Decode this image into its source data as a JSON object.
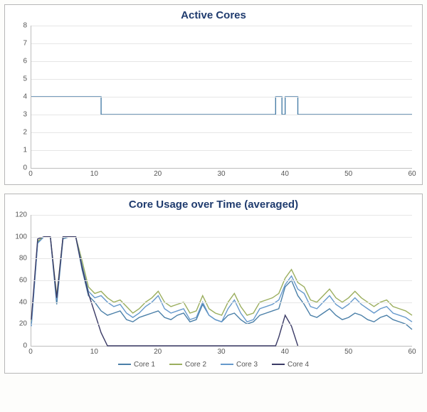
{
  "chart_data": [
    {
      "type": "line",
      "title": "Active Cores",
      "xlabel": "",
      "ylabel": "",
      "xlim": [
        0,
        60
      ],
      "ylim": [
        0,
        8
      ],
      "xticks": [
        0,
        10,
        20,
        30,
        40,
        50,
        60
      ],
      "yticks": [
        0,
        1,
        2,
        3,
        4,
        5,
        6,
        7,
        8
      ],
      "series": [
        {
          "name": "Active Cores",
          "color": "#4a7fa8",
          "x": [
            0,
            11,
            11,
            38.5,
            38.5,
            39.5,
            39.5,
            40,
            40,
            42,
            42,
            60
          ],
          "values": [
            4,
            4,
            3,
            3,
            4,
            4,
            3,
            3,
            4,
            4,
            3,
            3
          ]
        }
      ]
    },
    {
      "type": "line",
      "title": "Core Usage over Time (averaged)",
      "xlabel": "",
      "ylabel": "",
      "xlim": [
        0,
        60
      ],
      "ylim": [
        0,
        120
      ],
      "xticks": [
        0,
        10,
        20,
        30,
        40,
        50,
        60
      ],
      "yticks": [
        0,
        20,
        40,
        60,
        80,
        100,
        120
      ],
      "series": [
        {
          "name": "Core 1",
          "color": "#4a7fa8",
          "x": [
            0,
            1,
            2,
            3,
            4,
            5,
            6,
            7,
            8,
            9,
            10,
            11,
            12,
            13,
            14,
            15,
            16,
            17,
            18,
            19,
            20,
            21,
            22,
            23,
            24,
            25,
            26,
            27,
            28,
            29,
            30,
            31,
            32,
            33,
            34,
            35,
            36,
            37,
            38,
            39,
            40,
            41,
            42,
            43,
            44,
            45,
            46,
            47,
            48,
            49,
            50,
            51,
            52,
            53,
            54,
            55,
            56,
            57,
            58,
            59,
            60
          ],
          "values": [
            20,
            95,
            100,
            100,
            38,
            98,
            100,
            100,
            70,
            46,
            40,
            32,
            28,
            30,
            32,
            24,
            22,
            26,
            28,
            30,
            32,
            26,
            24,
            28,
            30,
            22,
            24,
            38,
            28,
            24,
            22,
            28,
            30,
            24,
            20,
            22,
            28,
            30,
            32,
            34,
            54,
            60,
            46,
            38,
            28,
            26,
            30,
            34,
            28,
            24,
            26,
            30,
            28,
            24,
            22,
            26,
            28,
            24,
            22,
            20,
            15
          ]
        },
        {
          "name": "Core 2",
          "color": "#9BAE5E",
          "x": [
            0,
            1,
            2,
            3,
            4,
            5,
            6,
            7,
            8,
            9,
            10,
            11,
            12,
            13,
            14,
            15,
            16,
            17,
            18,
            19,
            20,
            21,
            22,
            23,
            24,
            25,
            26,
            27,
            28,
            29,
            30,
            31,
            32,
            33,
            34,
            35,
            36,
            37,
            38,
            39,
            40,
            41,
            42,
            43,
            44,
            45,
            46,
            47,
            48,
            49,
            50,
            51,
            52,
            53,
            54,
            55,
            56,
            57,
            58,
            59,
            60
          ],
          "values": [
            22,
            96,
            100,
            100,
            46,
            100,
            100,
            100,
            78,
            54,
            48,
            50,
            44,
            40,
            42,
            36,
            30,
            34,
            40,
            44,
            50,
            40,
            36,
            38,
            40,
            30,
            32,
            46,
            34,
            30,
            28,
            40,
            48,
            36,
            28,
            30,
            40,
            42,
            44,
            48,
            62,
            70,
            58,
            54,
            42,
            40,
            46,
            52,
            44,
            40,
            44,
            50,
            44,
            40,
            36,
            40,
            42,
            36,
            34,
            32,
            28
          ]
        },
        {
          "name": "Core 3",
          "color": "#6699cc",
          "x": [
            0,
            1,
            2,
            3,
            4,
            5,
            6,
            7,
            8,
            9,
            10,
            11,
            12,
            13,
            14,
            15,
            16,
            17,
            18,
            19,
            20,
            21,
            22,
            23,
            24,
            25,
            26,
            27,
            28,
            29,
            30,
            31,
            32,
            33,
            34,
            35,
            36,
            37,
            38,
            39,
            40,
            41,
            42,
            43,
            44,
            45,
            46,
            47,
            48,
            49,
            50,
            51,
            52,
            53,
            54,
            55,
            56,
            57,
            58,
            59,
            60
          ],
          "values": [
            18,
            94,
            100,
            100,
            42,
            100,
            100,
            100,
            74,
            50,
            44,
            46,
            40,
            36,
            38,
            30,
            26,
            30,
            36,
            40,
            46,
            34,
            30,
            32,
            34,
            24,
            26,
            40,
            28,
            24,
            22,
            34,
            42,
            30,
            22,
            24,
            34,
            36,
            38,
            42,
            56,
            64,
            52,
            48,
            36,
            34,
            40,
            46,
            38,
            34,
            38,
            44,
            38,
            34,
            30,
            34,
            36,
            30,
            28,
            26,
            22
          ]
        },
        {
          "name": "Core 4",
          "color": "#3b3b66",
          "x": [
            0,
            1,
            2,
            3,
            4,
            5,
            6,
            7,
            8,
            9,
            10,
            11,
            12,
            38.5,
            39,
            40,
            41,
            42
          ],
          "values": [
            24,
            98,
            100,
            100,
            44,
            100,
            100,
            100,
            72,
            48,
            30,
            12,
            0,
            0,
            8,
            28,
            18,
            0
          ]
        }
      ]
    }
  ]
}
